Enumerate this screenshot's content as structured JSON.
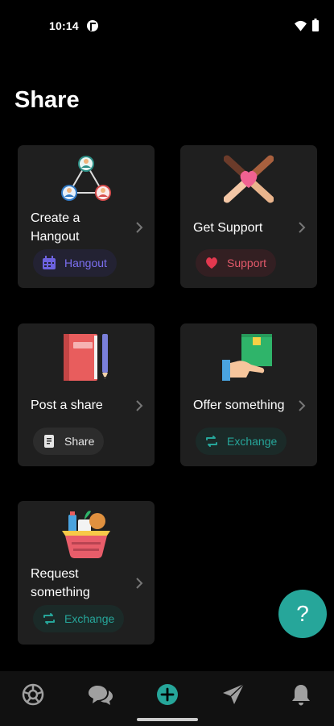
{
  "status_bar": {
    "time": "10:14"
  },
  "page": {
    "title": "Share"
  },
  "cards": [
    {
      "label_lines": [
        "Create a",
        "Hangout"
      ],
      "badge": "Hangout",
      "illustration": "group-network-icon"
    },
    {
      "label_lines": [
        "Get Support"
      ],
      "badge": "Support",
      "illustration": "helping-hands-heart-icon"
    },
    {
      "label_lines": [
        "Post a share"
      ],
      "badge": "Share",
      "illustration": "notebook-pen-icon"
    },
    {
      "label_lines": [
        "Offer something"
      ],
      "badge": "Exchange",
      "illustration": "hand-giving-box-icon"
    },
    {
      "label_lines": [
        "Request",
        "something"
      ],
      "badge": "Exchange",
      "illustration": "grocery-basket-icon"
    }
  ],
  "fab": {
    "label": "?"
  },
  "bottom_nav": {
    "items": [
      "explore-icon",
      "chat-icon",
      "add-circle-icon",
      "send-icon",
      "bell-icon"
    ]
  },
  "colors": {
    "background": "#000000",
    "card": "#1f1f1f",
    "hangout_badge_text": "#7b6ff0",
    "support_badge_text": "#e3596a",
    "exchange_badge_text": "#26a69a",
    "fab": "#26a69a"
  }
}
